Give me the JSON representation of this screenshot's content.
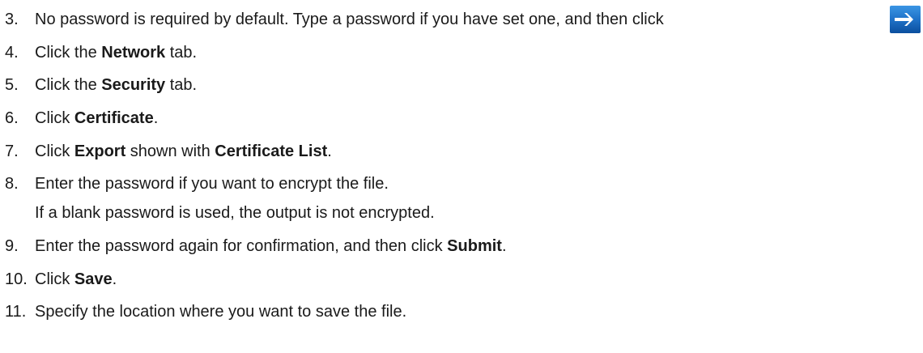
{
  "steps": [
    {
      "number": "3.",
      "text": "No password is required by default. Type a password if you have set one, and then click",
      "icon": "arrow-right-icon"
    },
    {
      "number": "4.",
      "before": "Click the ",
      "bold": "Network",
      "after": " tab."
    },
    {
      "number": "5.",
      "before": "Click the ",
      "bold": "Security",
      "after": " tab."
    },
    {
      "number": "6.",
      "before": "Click ",
      "bold": "Certificate",
      "after": "."
    },
    {
      "number": "7.",
      "before": "Click ",
      "bold": "Export",
      "middle": " shown with ",
      "bold2": "Certificate List",
      "after": "."
    },
    {
      "number": "8.",
      "text": "Enter the password if you want to encrypt the file.",
      "note": "If a blank password is used, the output is not encrypted."
    },
    {
      "number": "9.",
      "before": "Enter the password again for confirmation, and then click ",
      "bold": "Submit",
      "after": "."
    },
    {
      "number": "10.",
      "before": "Click ",
      "bold": "Save",
      "after": "."
    },
    {
      "number": "11.",
      "text": "Specify the location where you want to save the file."
    }
  ],
  "colors": {
    "text": "#1a1a1a",
    "icon_bg_top": "#2a86d8",
    "icon_bg_bottom": "#0b4f9e",
    "icon_arrow": "#ffffff"
  }
}
